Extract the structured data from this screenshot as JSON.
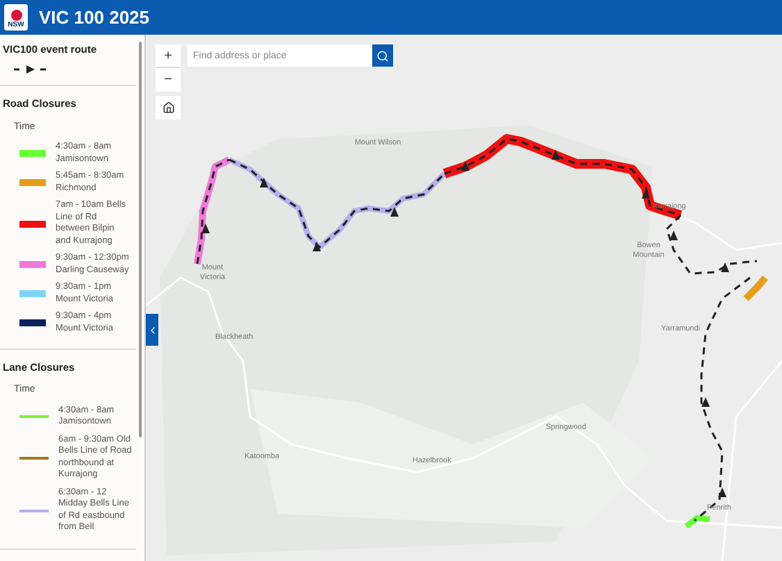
{
  "header": {
    "logo_text": "NSW",
    "title": "VIC 100 2025"
  },
  "sidebar": {
    "event_route": {
      "title": "VIC100 event route"
    },
    "sections": [
      {
        "title": "Road Closures",
        "kind": "road",
        "column_header": "Time",
        "items": [
          {
            "text": "4:30am - 8am Jamisontown",
            "color": "#66ff33"
          },
          {
            "text": "5:45am - 8:30am Richmond",
            "color": "#e69e1a"
          },
          {
            "text": "7am - 10am Bells Line of Rd between Bilpin and Kurrajong",
            "color": "#ee1111"
          },
          {
            "text": "9:30am - 12:30pm Darling Causeway",
            "color": "#f07ad8"
          },
          {
            "text": "9:30am - 1pm Mount Victoria",
            "color": "#7fd4f5"
          },
          {
            "text": "9:30am - 4pm Mount Victoria",
            "color": "#0c1f5e"
          }
        ]
      },
      {
        "title": "Lane Closures",
        "kind": "lane",
        "column_header": "Time",
        "items": [
          {
            "text": "4:30am - 8am Jamisontown",
            "color": "#7ef03c"
          },
          {
            "text": "6am - 9:30am Old Bells Line of Road northbound at Kurrajong",
            "color": "#a27a1e"
          },
          {
            "text": "6:30am - 12 Midday Bells Line of Rd eastbound from Bell",
            "color": "#b4b0ee"
          }
        ]
      }
    ]
  },
  "map": {
    "zoom_in": "+",
    "zoom_out": "−",
    "search": {
      "placeholder": "Find address or place"
    },
    "place_labels": [
      "Mount Wilson",
      "Mount Victoria",
      "Blackheath",
      "Kurrajong",
      "Bowen Mountain",
      "Yarramundi",
      "Springwood",
      "Katoomba",
      "Hazelbrook",
      "Penrith"
    ]
  }
}
